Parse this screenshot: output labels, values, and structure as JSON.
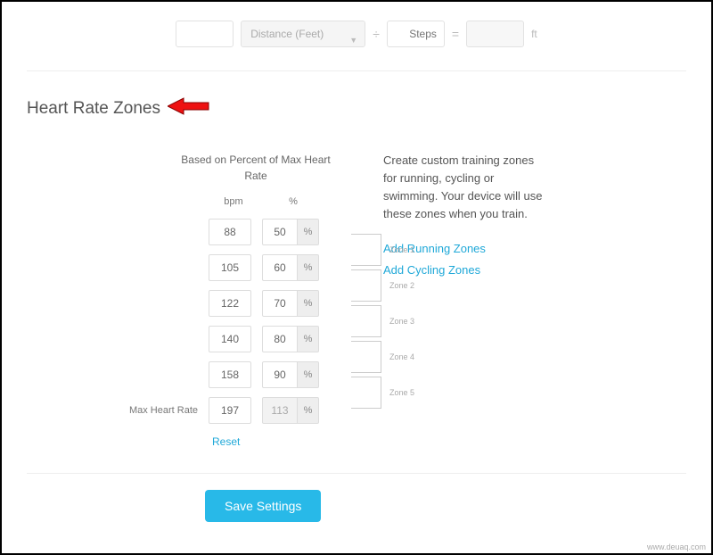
{
  "top": {
    "distance_value": "",
    "distance_placeholder": "Distance (Feet)",
    "divide": "÷",
    "steps_value": "",
    "steps_placeholder": "Steps",
    "equals": "=",
    "result": "",
    "unit": "ft"
  },
  "section": {
    "title": "Heart Rate Zones"
  },
  "hr": {
    "subtitle": "Based on Percent of Max Heart Rate",
    "col_bpm": "bpm",
    "col_pct": "%",
    "zones": [
      {
        "bpm": "88",
        "pct": "50",
        "label": "Zone 1"
      },
      {
        "bpm": "105",
        "pct": "60",
        "label": "Zone 2"
      },
      {
        "bpm": "122",
        "pct": "70",
        "label": "Zone 3"
      },
      {
        "bpm": "140",
        "pct": "80",
        "label": "Zone 4"
      },
      {
        "bpm": "158",
        "pct": "90",
        "label": "Zone 5"
      }
    ],
    "max_label": "Max Heart Rate",
    "max_bpm": "197",
    "max_pct": "113",
    "pct_sym": "%",
    "reset": "Reset"
  },
  "side": {
    "desc": "Create custom training zones for running, cycling or swimming. Your device will use these zones when you train.",
    "add_running": "Add Running Zones",
    "add_cycling": "Add Cycling Zones"
  },
  "save": {
    "label": "Save Settings"
  },
  "watermark": "www.deuaq.com"
}
